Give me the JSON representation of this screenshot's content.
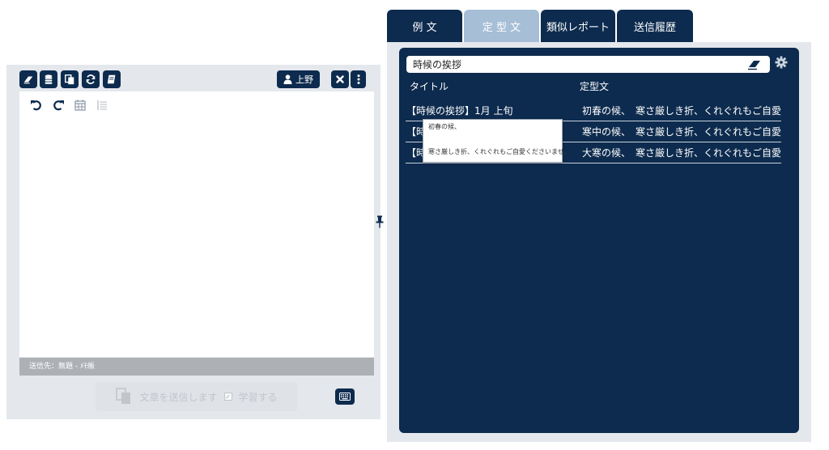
{
  "left": {
    "user_name": "上野",
    "status_text": "送信先：無題 - ﾒﾓ帳",
    "send_label": "文章を送信します",
    "learn_label": "学習する",
    "learn_checked": true
  },
  "tabs": [
    {
      "label": "例 文",
      "active": false
    },
    {
      "label": "定 型 文",
      "active": true
    },
    {
      "label": "類似レポート",
      "active": false
    },
    {
      "label": "送信履歴",
      "active": false
    }
  ],
  "search": {
    "value": "時候の挨拶"
  },
  "table": {
    "columns": [
      "タイトル",
      "定型文"
    ],
    "rows": [
      {
        "title": "【時候の挨拶】1月 上旬",
        "body": "初春の候、　寒さ厳しき折、くれぐれもご自愛くださ"
      },
      {
        "title": "【時",
        "body": "寒中の候、　寒さ厳しき折、くれぐれもご自愛くださ"
      },
      {
        "title": "【時",
        "body": "大寒の候、　寒さ厳しき折、くれぐれもご自愛くださ"
      }
    ]
  },
  "tooltip": {
    "line1": "初春の候、",
    "line2": "寒さ厳しき折、くれぐれもご自愛くださいませ。"
  },
  "colors": {
    "navy": "#0d2b4e",
    "active_tab": "#a6bed6",
    "panel_bg": "#e4e8ec",
    "status_bar": "#adb1b6"
  }
}
